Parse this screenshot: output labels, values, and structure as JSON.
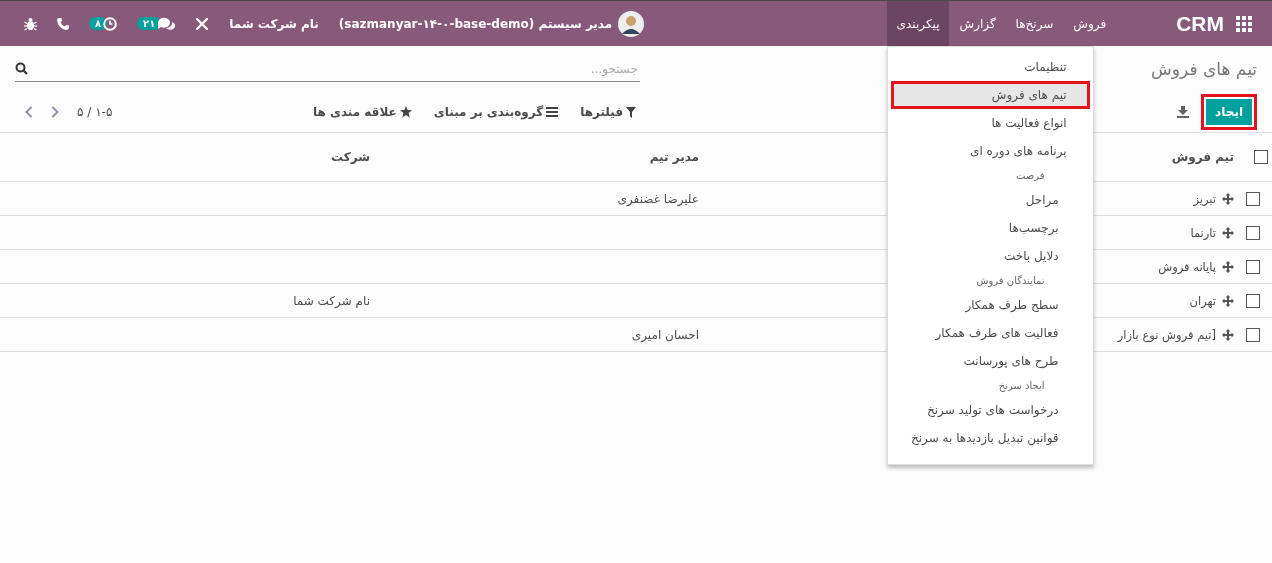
{
  "navbar": {
    "brand": "CRM",
    "menus": [
      {
        "label": "فروش",
        "selected": false
      },
      {
        "label": "سرنخ‌ها",
        "selected": false
      },
      {
        "label": "گزارش",
        "selected": false
      },
      {
        "label": "پیکربندی",
        "selected": true,
        "items": [
          {
            "kind": "item",
            "label": "تنظیمات",
            "selected": false,
            "highlighted": false
          },
          {
            "kind": "item",
            "label": "تیم های فروش",
            "selected": true,
            "highlighted": true
          },
          {
            "kind": "item",
            "label": "انواع فعالیت ها",
            "selected": false,
            "highlighted": false
          },
          {
            "kind": "item",
            "label": "برنامه های دوره ای",
            "selected": false,
            "highlighted": false
          },
          {
            "kind": "header",
            "label": "فرصت"
          },
          {
            "kind": "subitem",
            "label": "مراحل",
            "selected": false,
            "highlighted": false
          },
          {
            "kind": "subitem",
            "label": "برچسب‌ها",
            "selected": false,
            "highlighted": false
          },
          {
            "kind": "subitem",
            "label": "دلایل باخت",
            "selected": false,
            "highlighted": false
          },
          {
            "kind": "header",
            "label": "نمایندگان فروش"
          },
          {
            "kind": "subitem",
            "label": "سطح طرف همکار",
            "selected": false,
            "highlighted": false
          },
          {
            "kind": "subitem",
            "label": "فعالیت های طرف همکار",
            "selected": false,
            "highlighted": false
          },
          {
            "kind": "subitem",
            "label": "طرح های پورسانت",
            "selected": false,
            "highlighted": false
          },
          {
            "kind": "header",
            "label": "ایجاد سرنخ"
          },
          {
            "kind": "subitem",
            "label": "درخواست های تولید سرنخ",
            "selected": false,
            "highlighted": false
          },
          {
            "kind": "subitem",
            "label": "قوانین تبدیل بازدیدها به سرنخ",
            "selected": false,
            "highlighted": false
          }
        ]
      }
    ],
    "systray": {
      "activities_count": "۸",
      "messages_count": "۲۱",
      "company": "نام شرکت شما",
      "user": "مدیر سیستم (sazmanyar-۱۴-۰-base-demo)"
    }
  },
  "control_panel": {
    "title": "تیم های فروش",
    "search": {
      "placeholder": "جستجو..."
    },
    "create_button": {
      "label": "ایجاد",
      "highlighted": true
    },
    "filters": [
      {
        "kind": "filter",
        "label": "فیلترها"
      },
      {
        "kind": "group",
        "label": "گروه‌بندی بر مبنای"
      },
      {
        "kind": "favorite",
        "label": "علاقه مندی ها"
      }
    ],
    "pager": "۱-۵ / ۵"
  },
  "table": {
    "header_checked": false,
    "columns": [
      "تیم فروش",
      "مدیر تیم",
      "شرکت"
    ],
    "rows": [
      {
        "checked": false,
        "name": "تبریز",
        "manager": "علیرضا غضنفری"
      },
      {
        "checked": false,
        "name": "تارنما"
      },
      {
        "checked": false,
        "name": "پایانه فروش"
      },
      {
        "checked": false,
        "name": "تهران",
        "company": "نام شرکت شما"
      },
      {
        "checked": false,
        "name": "[تیم فروش نوع بازار",
        "manager": "احسان امیری"
      }
    ]
  }
}
